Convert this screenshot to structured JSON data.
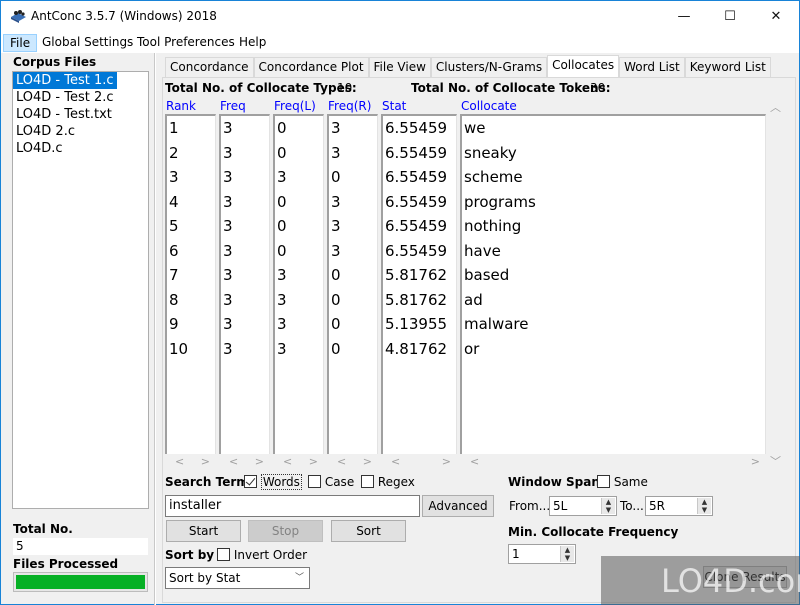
{
  "window": {
    "title": "AntConc 3.5.7 (Windows) 2018",
    "minimize_glyph": "—",
    "maximize_glyph": "☐",
    "close_glyph": "✕"
  },
  "menu": [
    {
      "label": "File"
    },
    {
      "label": "Global Settings"
    },
    {
      "label": "Tool Preferences"
    },
    {
      "label": "Help"
    }
  ],
  "sidebar": {
    "corpus_label": "Corpus Files",
    "files": [
      "LO4D - Test 1.c",
      "LO4D - Test 2.c",
      "LO4D - Test.txt",
      "LO4D 2.c",
      "LO4D.c"
    ],
    "selected_index": 0,
    "total_label": "Total No.",
    "total_value": "5",
    "processed_label": "Files Processed",
    "processed_progress": 1.0
  },
  "tabs": [
    {
      "label": "Concordance"
    },
    {
      "label": "Concordance Plot"
    },
    {
      "label": "File View"
    },
    {
      "label": "Clusters/N-Grams"
    },
    {
      "label": "Collocates",
      "active": true
    },
    {
      "label": "Word List"
    },
    {
      "label": "Keyword List"
    }
  ],
  "stats": {
    "types_label": "Total No. of Collocate Types:",
    "types_value": "10",
    "tokens_label": "Total No. of Collocate Tokens:",
    "tokens_value": "30"
  },
  "table": {
    "headers": [
      "Rank",
      "Freq",
      "Freq(L)",
      "Freq(R)",
      "Stat",
      "Collocate"
    ],
    "rows": [
      [
        "1",
        "3",
        "0",
        "3",
        "6.55459",
        "we"
      ],
      [
        "2",
        "3",
        "0",
        "3",
        "6.55459",
        "sneaky"
      ],
      [
        "3",
        "3",
        "3",
        "0",
        "6.55459",
        "scheme"
      ],
      [
        "4",
        "3",
        "0",
        "3",
        "6.55459",
        "programs"
      ],
      [
        "5",
        "3",
        "0",
        "3",
        "6.55459",
        "nothing"
      ],
      [
        "6",
        "3",
        "0",
        "3",
        "6.55459",
        "have"
      ],
      [
        "7",
        "3",
        "3",
        "0",
        "5.81762",
        "based"
      ],
      [
        "8",
        "3",
        "3",
        "0",
        "5.81762",
        "ad"
      ],
      [
        "9",
        "3",
        "3",
        "0",
        "5.13955",
        "malware"
      ],
      [
        "10",
        "3",
        "3",
        "0",
        "4.81762",
        "or"
      ]
    ]
  },
  "search": {
    "label": "Search Term",
    "words_label": "Words",
    "words_checked": true,
    "case_label": "Case",
    "case_checked": false,
    "regex_label": "Regex",
    "regex_checked": false,
    "value": "installer",
    "advanced_label": "Advanced",
    "start_label": "Start",
    "stop_label": "Stop",
    "sort_label": "Sort"
  },
  "sort": {
    "label": "Sort by",
    "invert_label": "Invert Order",
    "invert_checked": false,
    "selected": "Sort by Stat"
  },
  "window_span": {
    "label": "Window Span",
    "same_label": "Same",
    "same_checked": false,
    "from_label": "From...",
    "from_value": "5L",
    "to_label": "To...",
    "to_value": "5R"
  },
  "min_freq": {
    "label": "Min. Collocate Frequency",
    "value": "1"
  },
  "clone_label": "Clone Results",
  "watermark": "LO4D.com"
}
